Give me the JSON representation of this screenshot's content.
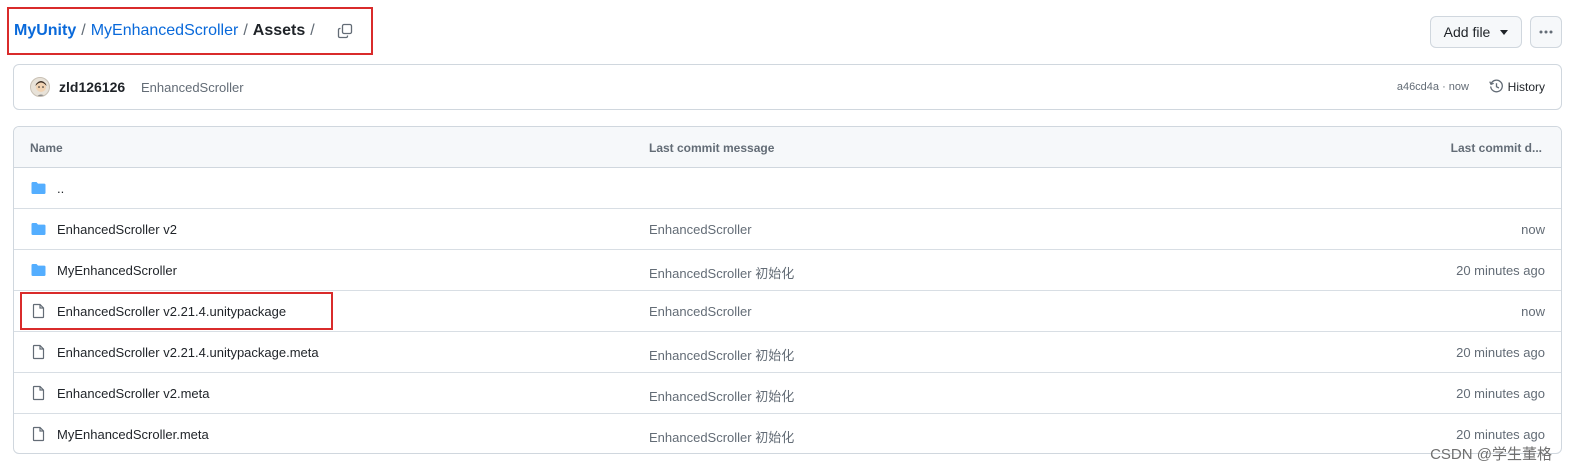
{
  "breadcrumb": {
    "repo": "MyUnity",
    "sep1": "/",
    "folder": "MyEnhancedScroller",
    "sep2": "/",
    "current": "Assets",
    "sep3": "/",
    "copy_icon": "copy-icon"
  },
  "toolbar": {
    "add_file_label": "Add file",
    "add_file_icon": "triangle-down-icon",
    "more_icon": "kebab-horizontal-icon"
  },
  "commit": {
    "user": "zld126126",
    "message": "EnhancedScroller",
    "meta": "a46cd4a · now",
    "history_label": "History",
    "history_icon": "history-icon"
  },
  "table": {
    "headers": {
      "name": "Name",
      "message": "Last commit message",
      "date": "Last commit d..."
    },
    "rows": [
      {
        "type": "folder",
        "icon": "folder-icon",
        "name": "..",
        "message": "",
        "date": ""
      },
      {
        "type": "folder",
        "icon": "folder-icon",
        "name": "EnhancedScroller v2",
        "message": "EnhancedScroller",
        "date": "now"
      },
      {
        "type": "folder",
        "icon": "folder-icon",
        "name": "MyEnhancedScroller",
        "message": "EnhancedScroller 初始化",
        "date": "20 minutes ago"
      },
      {
        "type": "file",
        "icon": "file-icon",
        "name": "EnhancedScroller v2.21.4.unitypackage",
        "message": "EnhancedScroller",
        "date": "now"
      },
      {
        "type": "file",
        "icon": "file-icon",
        "name": "EnhancedScroller v2.21.4.unitypackage.meta",
        "message": "EnhancedScroller 初始化",
        "date": "20 minutes ago"
      },
      {
        "type": "file",
        "icon": "file-icon",
        "name": "EnhancedScroller v2.meta",
        "message": "EnhancedScroller 初始化",
        "date": "20 minutes ago"
      },
      {
        "type": "file",
        "icon": "file-icon",
        "name": "MyEnhancedScroller.meta",
        "message": "EnhancedScroller 初始化",
        "date": "20 minutes ago"
      }
    ]
  },
  "colors": {
    "link": "#0969da",
    "folder": "#54aeff",
    "highlight": "#d92b2b"
  },
  "watermark": "CSDN @学生董格"
}
